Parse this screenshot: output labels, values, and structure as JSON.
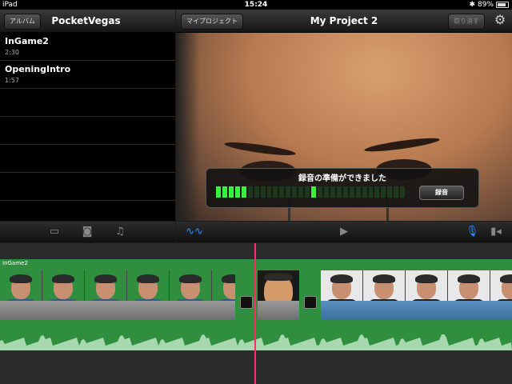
{
  "status": {
    "carrier": "iPad",
    "time": "15:24",
    "battery": "89%"
  },
  "left_nav": {
    "back_label": "アルバム",
    "title": "PocketVegas"
  },
  "clips": [
    {
      "name": "InGame2",
      "duration": "2:30"
    },
    {
      "name": "OpeningIntro",
      "duration": "1:57"
    }
  ],
  "right_nav": {
    "back_label": "マイプロジェクト",
    "title": "My Project 2",
    "undo_label": "取り消す"
  },
  "hud": {
    "message": "録音の準備ができました",
    "button": "録音",
    "meter_level": 0.35
  },
  "timeline": {
    "track_label": "InGame2"
  },
  "icons": [
    "gear-icon",
    "video-icon",
    "camera-icon",
    "music-icon",
    "waveform-icon",
    "play-icon",
    "mic-icon",
    "camcorder-icon"
  ],
  "colors": {
    "track_green": "#2f8f3f",
    "playhead": "#ff2a6a",
    "meter_on": "#3cf03c",
    "mic_blue": "#2a8cff"
  }
}
